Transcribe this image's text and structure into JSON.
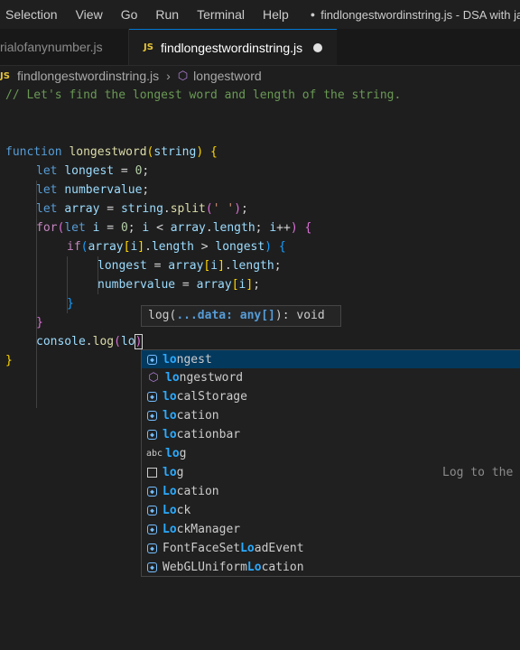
{
  "menubar": {
    "items": [
      "Selection",
      "View",
      "Go",
      "Run",
      "Terminal",
      "Help"
    ],
    "window_title": "findlongestwordinstring.js - DSA with ja"
  },
  "tabs": {
    "inactive_label": "rialofanynumber.js",
    "active_label": "findlongestwordinstring.js",
    "active_icon": "JS"
  },
  "breadcrumb": {
    "file": "findlongestwordinstring.js",
    "symbol": "longestword"
  },
  "code": {
    "comment": "// Let's find the longest word and length of the string.",
    "fn_keyword": "function",
    "fn_name": "longestword",
    "fn_param": "string",
    "let": "let",
    "longest": "longest",
    "zero": "0",
    "numbervalue": "numbervalue",
    "array": "array",
    "split_call": "split",
    "split_arg": "' '",
    "for_kw": "for",
    "if_kw": "if",
    "i": "i",
    "length": "length",
    "console": "console",
    "log": "log",
    "typed": "lo"
  },
  "hint": {
    "signature": "log(...data: any[]): void"
  },
  "suggestions": {
    "items": [
      {
        "icon": "variable-icon",
        "match": "lo",
        "rest": "ngest"
      },
      {
        "icon": "method-icon",
        "match": "lo",
        "rest": "ngestword"
      },
      {
        "icon": "variable-icon",
        "match": "lo",
        "rest": "calStorage"
      },
      {
        "icon": "variable-icon",
        "match": "lo",
        "rest": "cation"
      },
      {
        "icon": "variable-icon",
        "match": "lo",
        "rest": "cationbar"
      },
      {
        "icon": "text-icon",
        "match": "lo",
        "rest": "g"
      },
      {
        "icon": "snippet-icon",
        "match": "lo",
        "rest": "g"
      },
      {
        "icon": "variable-icon",
        "match": "Lo",
        "rest": "cation"
      },
      {
        "icon": "variable-icon",
        "match": "Lo",
        "rest": "ck"
      },
      {
        "icon": "variable-icon",
        "match": "Lo",
        "rest": "ckManager"
      },
      {
        "icon": "variable-icon",
        "pre": "FontFaceSet",
        "match": "Lo",
        "rest": "adEvent"
      },
      {
        "icon": "variable-icon",
        "pre": "WebGLUniform",
        "match": "Lo",
        "rest": "cation"
      }
    ],
    "detail": "Log to the co"
  }
}
